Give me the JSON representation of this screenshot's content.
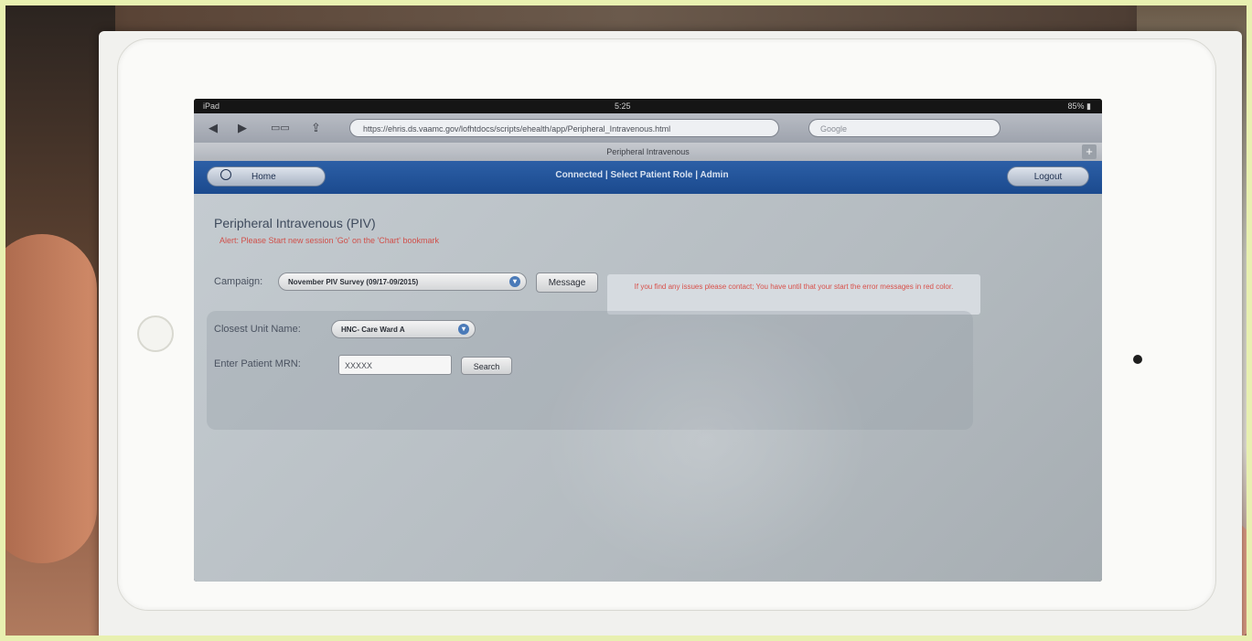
{
  "status_bar": {
    "carrier": "iPad",
    "time": "5:25",
    "battery": "85% ▮"
  },
  "browser": {
    "back_label": "◀",
    "forward_label": "▶",
    "bookmarks_label": "▭▭",
    "share_label": "⇪",
    "url": "https://ehris.ds.vaamc.gov/lofhtdocs/scripts/ehealth/app/Peripheral_Intravenous.html",
    "search_placeholder": "Google",
    "page_tab_title": "Peripheral Intravenous",
    "new_tab_label": "+"
  },
  "app_header": {
    "home_label": "Home",
    "title": "Connected | Select Patient Role | Admin",
    "logout_label": "Logout"
  },
  "page": {
    "heading": "Peripheral Intravenous (PIV)",
    "alert": "Alert: Please Start new session 'Go' on the 'Chart' bookmark",
    "campaign_label": "Campaign:",
    "campaign_value": "November PIV Survey (09/17-09/2015)",
    "message_label": "Message",
    "message_text": "If you find any issues please contact; You have until that your start the error messages in red color.",
    "ward_label": "Closest Unit Name:",
    "ward_value": "HNC- Care Ward A",
    "patient_label": "Enter Patient MRN:",
    "patient_value": "XXXXX",
    "search_label": "Search"
  },
  "colors": {
    "header_blue": "#1b4a8e",
    "alert_red": "#d0504a",
    "content_gray": "#b4bbc0"
  }
}
